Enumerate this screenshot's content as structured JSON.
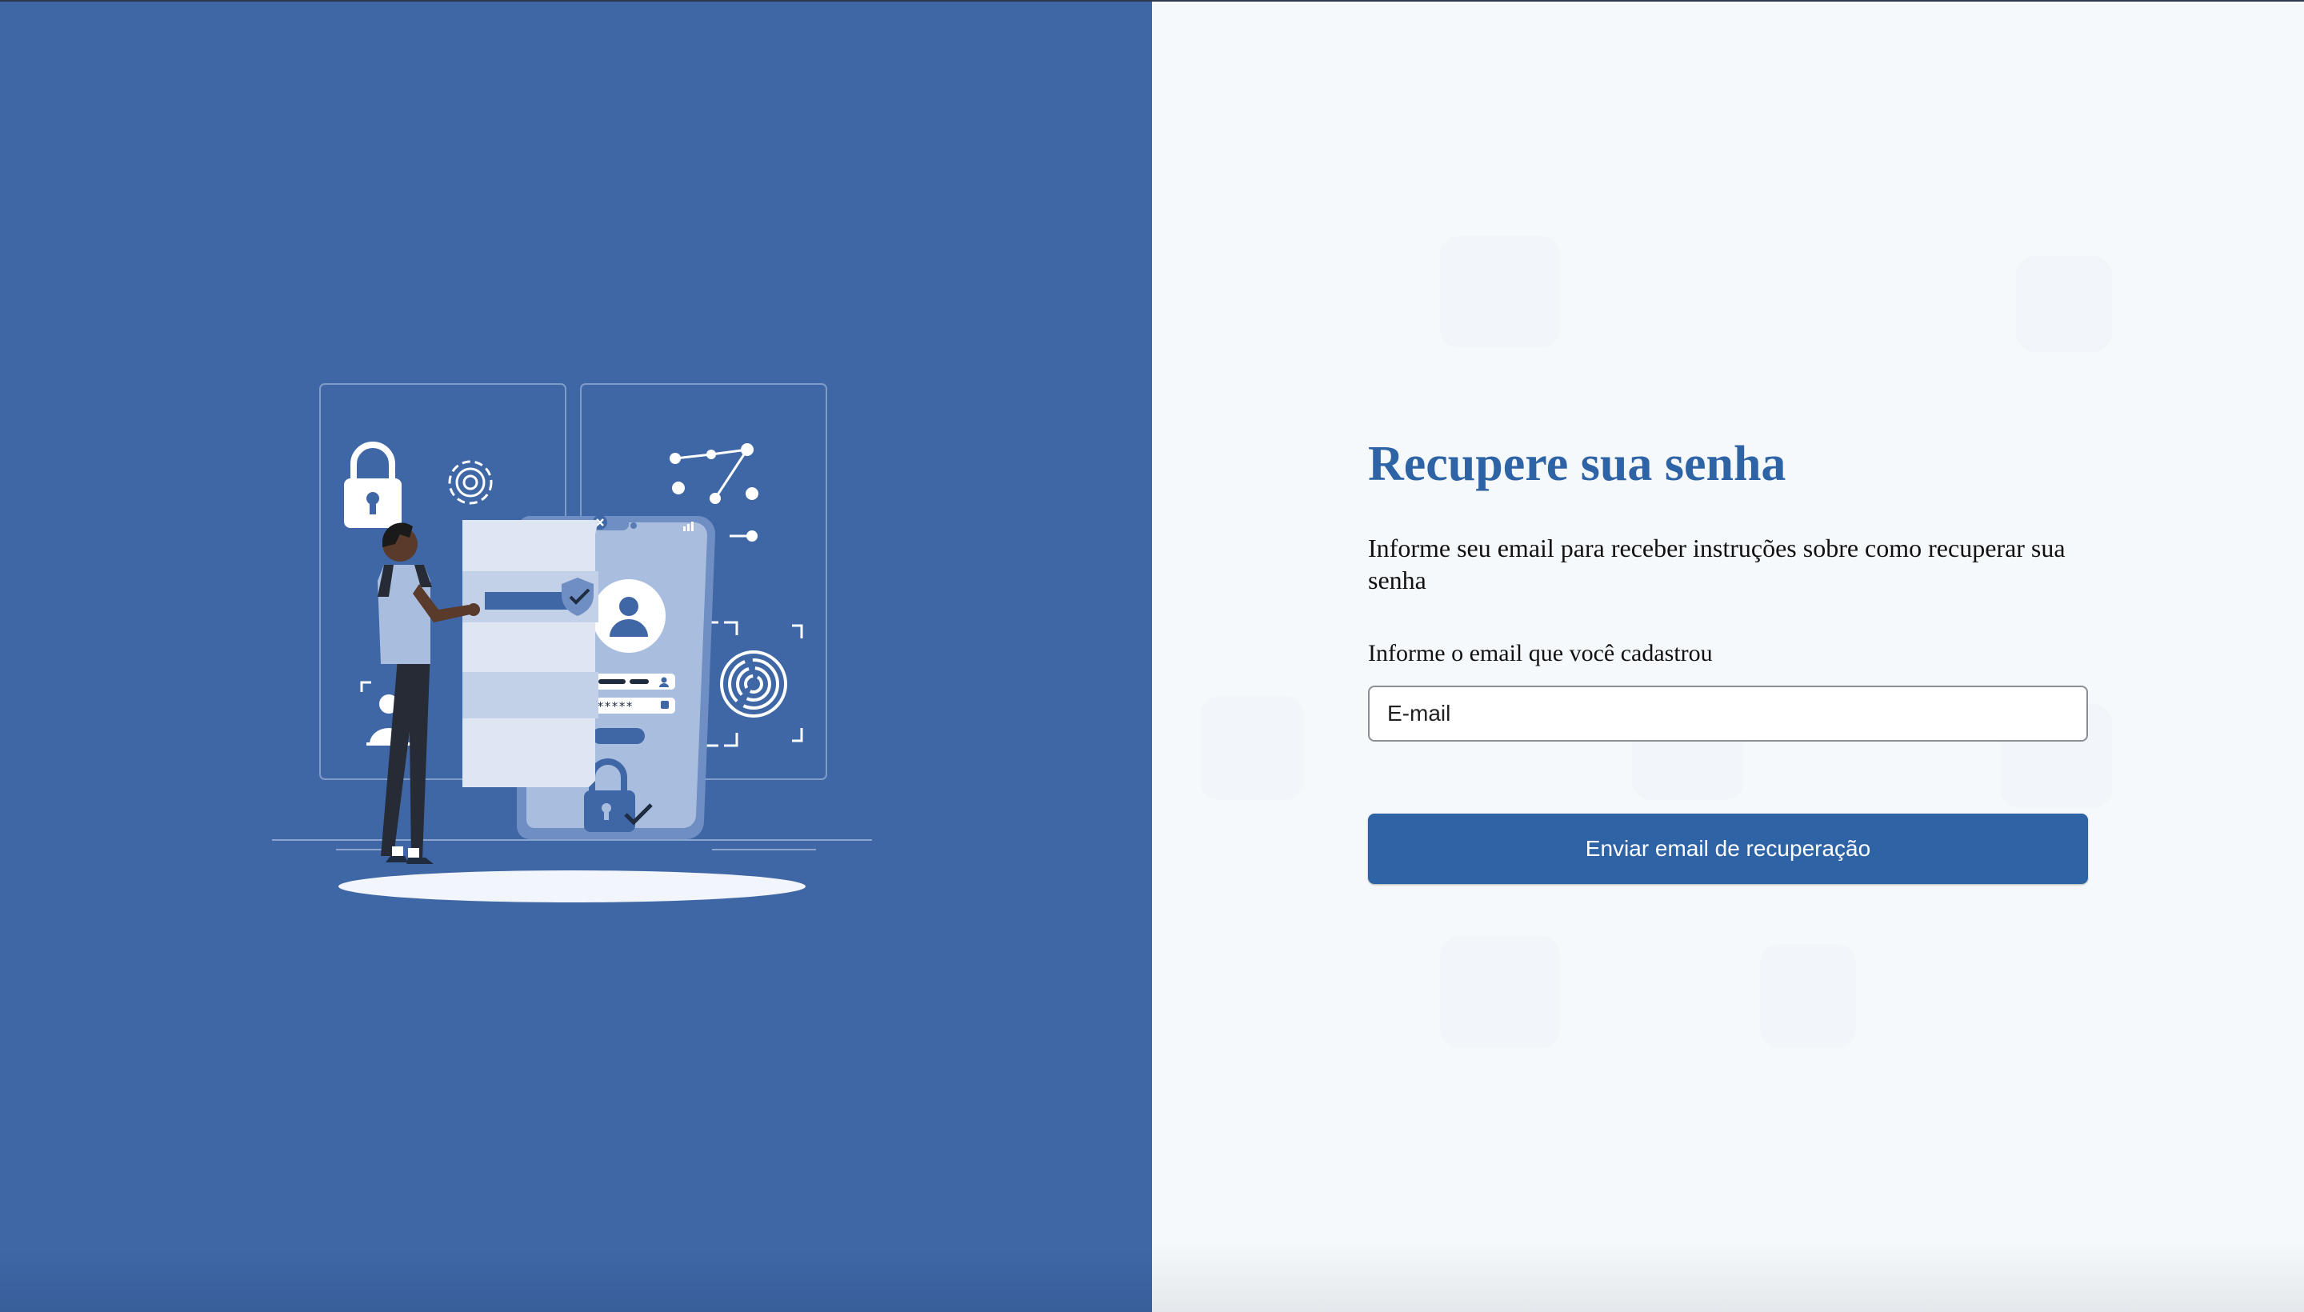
{
  "left_panel": {
    "background_color": "#3f67a6",
    "illustration": {
      "icons": [
        "padlock-icon",
        "gear-icon",
        "user-frame-icon",
        "network-nodes-icon",
        "fingerprint-icon",
        "shield-check-icon",
        "user-avatar-icon",
        "close-icon",
        "signal-icon",
        "lock-check-icon"
      ],
      "password_mask": "*****"
    }
  },
  "form": {
    "title": "Recupere sua senha",
    "subtitle": "Informe seu email para receber instruções sobre como recuperar sua senha",
    "email_label": "Informe o email que você cadastrou",
    "email_value": "",
    "email_placeholder": "E-mail",
    "submit_label": "Enviar email de recuperação"
  },
  "colors": {
    "accent": "#2e63a5",
    "left_background": "#3f67a6",
    "right_background": "#f6f9fb"
  }
}
